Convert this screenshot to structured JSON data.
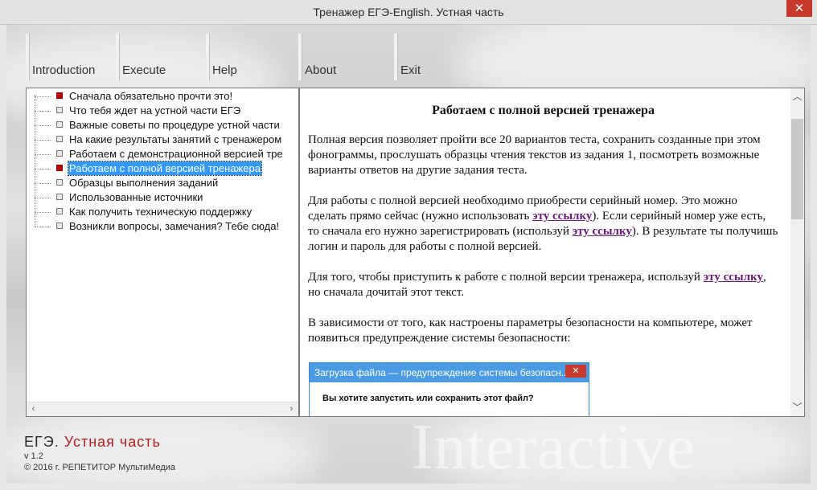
{
  "window": {
    "title": "Тренажер ЕГЭ-English. Устная часть",
    "close_glyph": "✕"
  },
  "menu": [
    {
      "label": "Introduction"
    },
    {
      "label": "Execute"
    },
    {
      "label": "Help"
    },
    {
      "label": "About"
    },
    {
      "label": "Exit"
    }
  ],
  "tree": {
    "items": [
      {
        "label": "Сначала обязательно прочти это!",
        "marker": "red"
      },
      {
        "label": "Что тебя ждет на устной части ЕГЭ",
        "marker": "gray"
      },
      {
        "label": "Важные советы по процедуре устной части",
        "marker": "gray"
      },
      {
        "label": "На какие результаты занятий с тренажером",
        "marker": "gray"
      },
      {
        "label": "Работаем с демонстрационной версией тре",
        "marker": "gray"
      },
      {
        "label": "Работаем с полной версией тренажера",
        "marker": "red",
        "selected": true
      },
      {
        "label": "Образцы выполнения заданий",
        "marker": "gray"
      },
      {
        "label": "Использованные источники",
        "marker": "gray"
      },
      {
        "label": "Как получить техническую поддержку",
        "marker": "gray"
      },
      {
        "label": "Возникли вопросы, замечания? Тебе сюда!",
        "marker": "gray"
      }
    ],
    "scroll_left": "‹",
    "scroll_right": "›"
  },
  "content": {
    "heading": "Работаем с полной версией тренажера",
    "p1": "Полная версия позволяет пройти все 20 вариантов теста, сохранить созданные при этом фонограммы, прослушать образцы чтения текстов из задания 1, посмотреть возможные варианты ответов на другие задания теста.",
    "p2_a": "Для работы с полной версией необходимо приобрести серийный номер. Это можно сделать прямо сейчас (нужно использовать ",
    "p2_link1": "эту ссылку",
    "p2_b": "). Если серийный номер уже есть, то сначала его нужно зарегистрировать (используй ",
    "p2_link2": "эту ссылку",
    "p2_c": "). В результате ты получишь логин и пароль для работы с полной версией.",
    "p3_a": "Для того, чтобы приступить к работе с полной версии тренажера, используй ",
    "p3_link": "эту ссылку",
    "p3_b": ", но сначала дочитай этот текст.",
    "p4": "В зависимости от того, как настроены параметры безопасности на компьютере, может появиться предупреждение системы безопасности:",
    "dialog_title": "Загрузка файла — предупреждение системы безопасн...",
    "dialog_close": "✕",
    "dialog_question": "Вы хотите запустить или сохранить этот файл?",
    "scroll_up": "︿",
    "scroll_down": "﹀"
  },
  "footer": {
    "title_a": "ЕГЭ.",
    "title_b": "Устная часть",
    "version": "v 1.2",
    "copyright": "© 2016 г. РЕПЕТИТОР МультиМедиа",
    "watermark": "Interactive"
  }
}
